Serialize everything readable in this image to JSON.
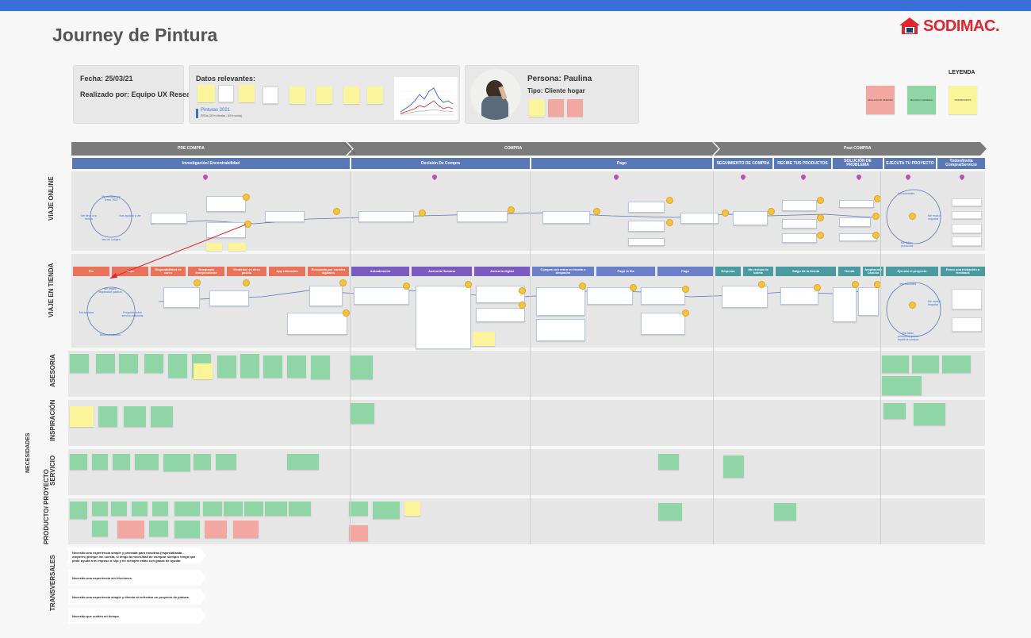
{
  "header": {
    "title": "Journey de Pintura",
    "logo_text": "SODIMAC."
  },
  "info": {
    "fecha_label": "Fecha: 25/03/21",
    "realizado_label": "Realizado por: Equipo UX Research",
    "datos_title": "Datos relevantes:",
    "pinturas_label": "Pinturas 2021",
    "pinturas_sub": "RRDs (20% clientes - 80% venta)",
    "persona_label": "Persona: Paulina",
    "tipo_label": "Tipo: Cliente hogar"
  },
  "legend": {
    "title": "LEYENDA",
    "items": [
      {
        "label": "APALANCAR DEMORA",
        "color": "#f2a8a0"
      },
      {
        "label": "NEGOCIO GENERAL",
        "color": "#8fd5a6"
      },
      {
        "label": "PRIORIZADOS",
        "color": "#fbf49a"
      }
    ]
  },
  "phases": [
    "PRE COMPRA",
    "COMPRA",
    "Post COMPRA"
  ],
  "online_stages": [
    "Investigación/ Encontrabilidad",
    "Decisión De Compra",
    "Pago",
    "SEGUIMIENTO DE COMPRA",
    "RECIBE TUS PRODUCTOS",
    "SOLUCIÓN DE PROBLEMA",
    "EJECUTA TU PROYECTO",
    "Todos/Invita Compra/Servicio"
  ],
  "lanes": {
    "online": "VIAJE ONLINE",
    "store": "VIAJE EN TIENDA",
    "needs": "NECESIDADES",
    "asesoria": "ASESORIA",
    "inspiracion": "INSPIRACIÓN",
    "servicio": "SERVICIO",
    "producto": "PRODUCTO/ PROYECTO",
    "transversales": "TRANSVERSALES"
  },
  "store_stages": [
    {
      "label": "Pre",
      "color": "#e8735a"
    },
    {
      "label": "Auto",
      "color": "#e8735a"
    },
    {
      "label": "Disponibilidad de carro",
      "color": "#e8735a"
    },
    {
      "label": "Búsqueda Independiente",
      "color": "#e8735a"
    },
    {
      "label": "Vendedor vs deco pasillo",
      "color": "#e8735a"
    },
    {
      "label": "App ubicación",
      "color": "#e8735a"
    },
    {
      "label": "Búsqueda por canales digitales",
      "color": "#e8735a"
    },
    {
      "label": "Autoatención",
      "color": "#7a5cc0"
    },
    {
      "label": "Asesoría Humana",
      "color": "#7a5cc0"
    },
    {
      "label": "Asesoría digital",
      "color": "#7a5cc0"
    },
    {
      "label": "Compra con retiro en tienda o despacho",
      "color": "#6b7fc6"
    },
    {
      "label": "Pago la fila",
      "color": "#6b7fc6"
    },
    {
      "label": "Pago",
      "color": "#6b7fc6"
    },
    {
      "label": "Empresa",
      "color": "#4a9aa0"
    },
    {
      "label": "Me revisan la boleta",
      "color": "#4a9aa0"
    },
    {
      "label": "Salgo de la tienda",
      "color": "#4a9aa0"
    },
    {
      "label": "Tienda",
      "color": "#4a9aa0"
    },
    {
      "label": "Ampliación Cambio",
      "color": "#4a9aa0"
    },
    {
      "label": "Ejecuto el proyecto",
      "color": "#4a9aa0"
    },
    {
      "label": "Envío una invitación a feedback",
      "color": "#4a9aa0"
    }
  ],
  "online_cycle": [
    "Me compro por Tema, REE",
    "Nos ayudan a ver",
    "Veo mi compra",
    "Me lleva a la tienda"
  ],
  "store_cycle": [
    "Me regalo inspiración pasillos",
    "Me asesora",
    "Pregunto sobre servicio adicional",
    "Busco productos"
  ],
  "post_cycle_online": [
    "Veo tutoriales",
    "Me mola a negociar",
    "Me faltan productos"
  ],
  "post_cycle_store": [
    "Veo tutoriales",
    "Me mola a negociar",
    "Me faltan productos quiero repetir la compra"
  ],
  "transversales": [
    "Necesito una experiencia simple y pensada para nosotras (especializada - mayores) porque me cuesta, si tengo la necesidad de comprar siempre tengo que pedir ayuda a mi esposo o hijo y no siempre están con ganas de ayudar.",
    "Necesito una experiencia sin fricciones",
    "Necesito una experiencia simple y directa al enfrentar un proyecto de pintura",
    "Necesito que cuiden mi tiempo"
  ]
}
